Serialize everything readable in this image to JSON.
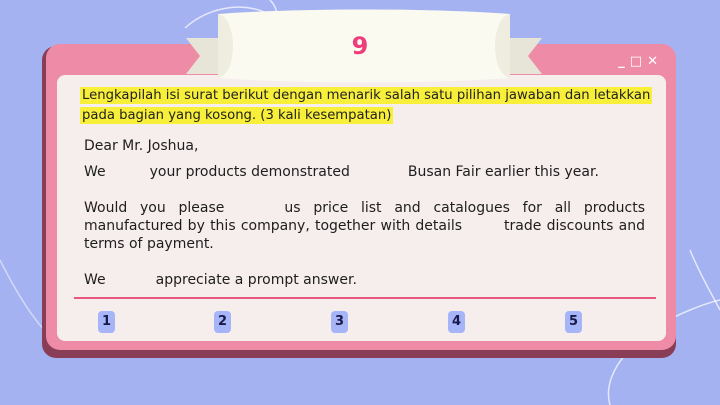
{
  "question_number": "9",
  "window_controls": [
    "_",
    "□",
    "✕"
  ],
  "instruction": "Lengkapilah isi surat berikut dengan menarik salah satu pilihan jawaban dan letakkan pada bagian yang kosong. (3 kali kesempatan)",
  "letter": {
    "salutation": "Dear Mr. Joshua,",
    "line1": {
      "a": "We",
      "b": "your products demonstrated",
      "c": "Busan Fair earlier this year."
    },
    "para2": {
      "a": "Would you please",
      "b": "us price list and catalogues for all products manufactured by this company, together with details",
      "c": "trade discounts and terms of payment."
    },
    "line3": {
      "a": "We",
      "b": "appreciate a prompt answer."
    }
  },
  "answer_slots": [
    "1",
    "2",
    "3",
    "4",
    "5"
  ],
  "colors": {
    "background": "#a4b2f2",
    "window_frame": "#ee8ca8",
    "window_inner": "#f6eded",
    "highlight": "#f8ef3a",
    "accent_number": "#ef3c7a",
    "slot": "#a6b4f8"
  }
}
